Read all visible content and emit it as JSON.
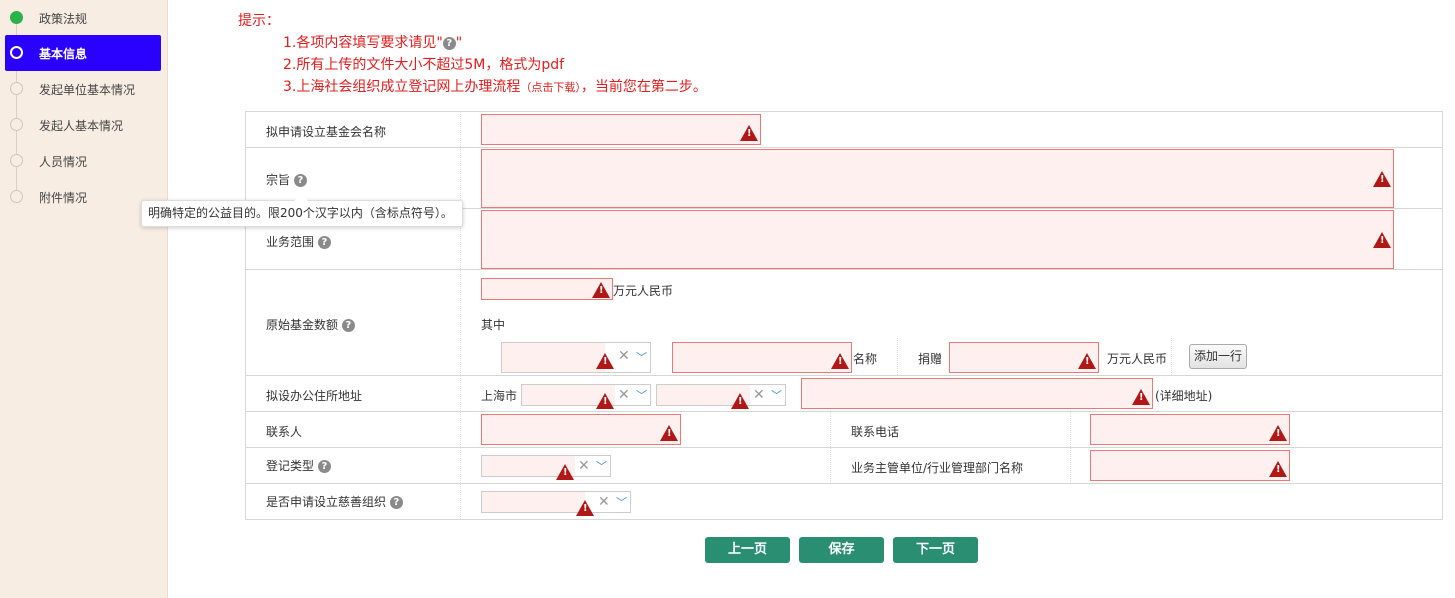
{
  "sidebar": {
    "items": [
      {
        "label": "政策法规"
      },
      {
        "label": "基本信息"
      },
      {
        "label": "发起单位基本情况"
      },
      {
        "label": "发起人基本情况"
      },
      {
        "label": "人员情况"
      },
      {
        "label": "附件情况"
      }
    ]
  },
  "tips": {
    "title": "提示：",
    "line1_prefix": "1.各项内容填写要求请见\"",
    "line1_suffix": "\"",
    "line2": "2.所有上传的文件大小不超过5M，格式为pdf",
    "line3_a": "3.上海社会组织成立登记网上办理流程",
    "line3_b": "（点击下载）",
    "line3_c": "，当前您在第二步。"
  },
  "form": {
    "foundation_name_label": "拟申请设立基金会名称",
    "purpose_label": "宗旨",
    "scope_label": "业务范围",
    "initial_fund_label": "原始基金数额",
    "fund_unit": "万元人民币",
    "of_which": "其中",
    "name_label": "名称",
    "donation_label": "捐赠",
    "donation_unit": "万元人民币",
    "add_row_button": "添加一行",
    "address_label": "拟设办公住所地址",
    "city": "上海市",
    "detail_address_hint": "(详细地址)",
    "contact_label": "联系人",
    "phone_label": "联系电话",
    "reg_type_label": "登记类型",
    "supervisor_label": "业务主管单位/行业管理部门名称",
    "charity_label": "是否申请设立慈善组织"
  },
  "tooltip": {
    "text": "明确特定的公益目的。限200个汉字以内（含标点符号）。"
  },
  "buttons": {
    "prev": "上一页",
    "save": "保存",
    "next": "下一页"
  },
  "colors": {
    "active_nav": "#2a00ff",
    "tip_red": "#e81b1b",
    "button_green": "#2a8f72",
    "error_bg": "#fff0f0"
  }
}
